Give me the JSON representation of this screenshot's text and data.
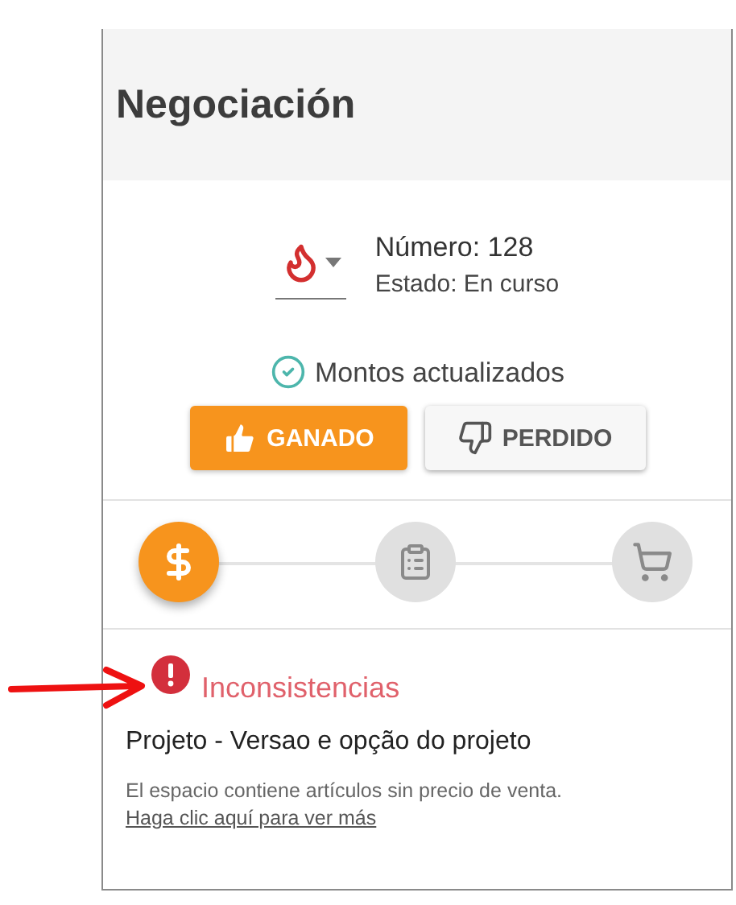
{
  "title": "Negociación",
  "deal": {
    "number": "Número: 128",
    "status": "Estado: En curso"
  },
  "sync_status": {
    "label": "Montos actualizados"
  },
  "buttons": [
    {
      "label": "GANADO",
      "kind": "won",
      "selected": true
    },
    {
      "label": "PERDIDO",
      "kind": "lost",
      "selected": false
    }
  ],
  "steps": [
    {
      "kind": "money",
      "selected": true
    },
    {
      "kind": "clipboard",
      "selected": false
    },
    {
      "kind": "cart",
      "selected": false
    }
  ],
  "alert": {
    "title": "Inconsistencias",
    "heading": "Projeto - Versao e opção do projeto",
    "message": "El espacio contiene artículos sin precio de venta.",
    "link": "Haga clic aquí para ver más"
  }
}
